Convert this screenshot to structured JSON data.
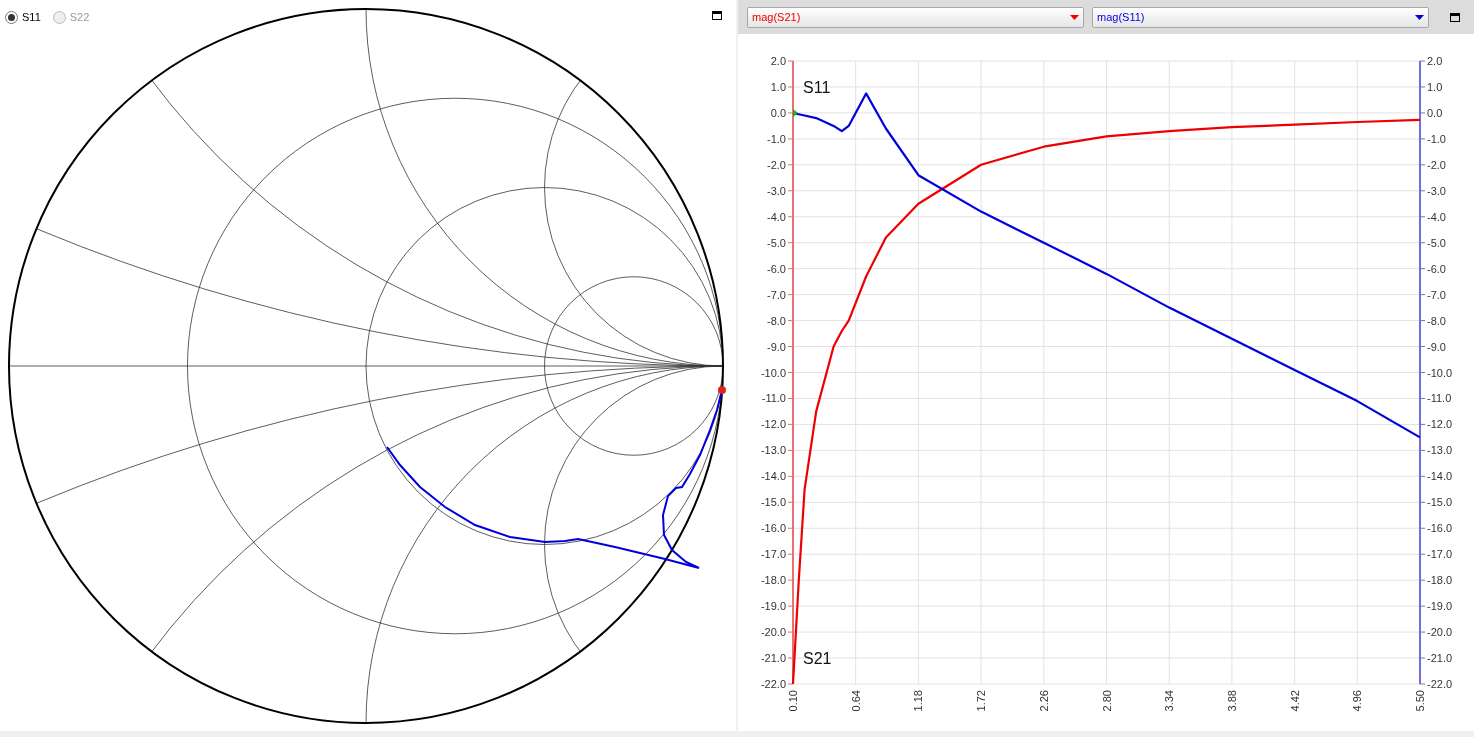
{
  "smith_panel": {
    "ports": [
      {
        "label": "S11",
        "selected": true
      },
      {
        "label": "S22",
        "selected": false
      }
    ]
  },
  "plot_panel": {
    "chart_data": {
      "type": "line",
      "x": [
        0.1,
        0.15,
        0.2,
        0.3,
        0.45,
        0.52,
        0.58,
        0.73,
        0.9,
        1.18,
        1.72,
        2.26,
        2.8,
        3.34,
        3.88,
        4.42,
        4.96,
        5.5
      ],
      "series": [
        {
          "name": "mag(S21)",
          "color": "#ee0000",
          "values": [
            -22,
            -18,
            -14.5,
            -11.5,
            -9,
            -8.4,
            -8,
            -6.3,
            -4.8,
            -3.5,
            -2.0,
            -1.3,
            -0.9,
            -0.7,
            -0.55,
            -0.45,
            -0.35,
            -0.27
          ]
        },
        {
          "name": "mag(S11)",
          "color": "#0000dd",
          "values": [
            0,
            -0.05,
            -0.1,
            -0.2,
            -0.5,
            -0.7,
            -0.5,
            0.75,
            -0.6,
            -2.4,
            -3.8,
            -5.0,
            -6.2,
            -7.5,
            -8.7,
            -9.9,
            -11.1,
            -12.5
          ]
        }
      ],
      "xlim": [
        0.1,
        5.5
      ],
      "ylim": [
        -22,
        2
      ],
      "xticks": [
        {
          "value": 0.1,
          "label": "0.10"
        },
        {
          "value": 0.64,
          "label": "0.64"
        },
        {
          "value": 1.18,
          "label": "1.18"
        },
        {
          "value": 1.72,
          "label": "1.72"
        },
        {
          "value": 2.26,
          "label": "2.26"
        },
        {
          "value": 2.8,
          "label": "2.80"
        },
        {
          "value": 3.34,
          "label": "3.34"
        },
        {
          "value": 3.88,
          "label": "3.88"
        },
        {
          "value": 4.42,
          "label": "4.42"
        },
        {
          "value": 4.96,
          "label": "4.96"
        },
        {
          "value": 5.5,
          "label": "5.50"
        }
      ],
      "yticks": [
        {
          "value": 2,
          "label": "2.0"
        },
        {
          "value": 1,
          "label": "1.0"
        },
        {
          "value": 0,
          "label": "0.0"
        },
        {
          "value": -1,
          "label": "-1.0"
        },
        {
          "value": -2,
          "label": "-2.0"
        },
        {
          "value": -3,
          "label": "-3.0"
        },
        {
          "value": -4,
          "label": "-4.0"
        },
        {
          "value": -5,
          "label": "-5.0"
        },
        {
          "value": -6,
          "label": "-6.0"
        },
        {
          "value": -7,
          "label": "-7.0"
        },
        {
          "value": -8,
          "label": "-8.0"
        },
        {
          "value": -9,
          "label": "-9.0"
        },
        {
          "value": -10,
          "label": "-10.0"
        },
        {
          "value": -11,
          "label": "-11.0"
        },
        {
          "value": -12,
          "label": "-12.0"
        },
        {
          "value": -13,
          "label": "-13.0"
        },
        {
          "value": -14,
          "label": "-14.0"
        },
        {
          "value": -15,
          "label": "-15.0"
        },
        {
          "value": -16,
          "label": "-16.0"
        },
        {
          "value": -17,
          "label": "-17.0"
        },
        {
          "value": -18,
          "label": "-18.0"
        },
        {
          "value": -19,
          "label": "-19.0"
        },
        {
          "value": -20,
          "label": "-20.0"
        },
        {
          "value": -21,
          "label": "-21.0"
        },
        {
          "value": -22,
          "label": "-22.0"
        }
      ],
      "grid": true,
      "annotations": [
        "S11",
        "S21"
      ]
    },
    "right_axis_labels": [
      "2.0",
      "1.0",
      "0.0",
      "-1.0",
      "-2.0",
      "-3.0",
      "-4.0",
      "-5.0",
      "-6.0",
      "-7.0",
      "-8.0",
      "-9.0",
      "-10.0",
      "-11.0",
      "-12.0",
      "-13.0",
      "-14.0",
      "-15.0",
      "-16.0",
      "-17.0",
      "-18.0",
      "-19.0",
      "-20.0",
      "-21.0",
      "-22.0"
    ]
  }
}
